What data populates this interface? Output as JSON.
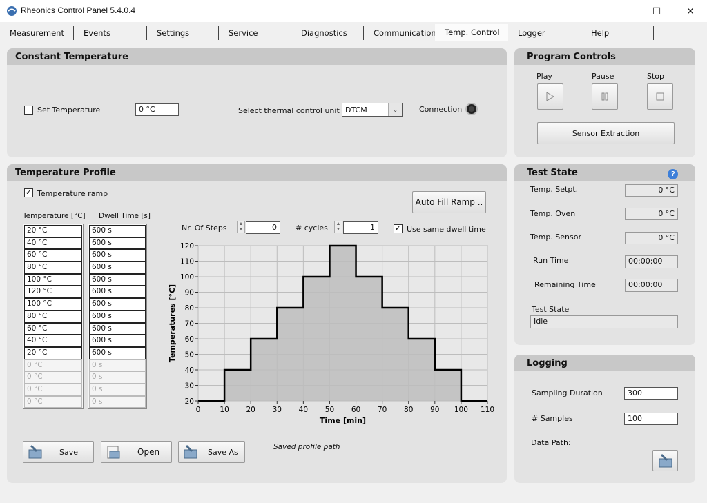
{
  "window": {
    "title": "Rheonics Control Panel 5.4.0.4",
    "min": "—",
    "max": "☐",
    "close": "✕"
  },
  "tabs": [
    {
      "label": "Measurement"
    },
    {
      "label": "Events"
    },
    {
      "label": "Settings"
    },
    {
      "label": "Service"
    },
    {
      "label": "Diagnostics"
    },
    {
      "label": "Communication"
    },
    {
      "label": "Temp. Control"
    },
    {
      "label": "Logger"
    },
    {
      "label": "Help"
    }
  ],
  "constant_temperature": {
    "title": "Constant Temperature",
    "set_temp_label": "Set Temperature",
    "set_temp_checked": false,
    "set_temp_value": "0 °C",
    "select_unit_label": "Select thermal control unit",
    "unit_value": "DTCM",
    "connection_label": "Connection"
  },
  "program_controls": {
    "title": "Program Controls",
    "play_label": "Play",
    "pause_label": "Pause",
    "stop_label": "Stop",
    "sensor_extraction_label": "Sensor Extraction"
  },
  "temperature_profile": {
    "title": "Temperature Profile",
    "ramp_label": "Temperature ramp",
    "ramp_checked": true,
    "auto_fill_label": "Auto Fill Ramp ..",
    "temp_col_header": "Temperature [°C]",
    "dwell_col_header": "Dwell Time [s]",
    "temperatures": [
      "20 °C",
      "40 °C",
      "60 °C",
      "80 °C",
      "100 °C",
      "120 °C",
      "100 °C",
      "80 °C",
      "60 °C",
      "40 °C",
      "20 °C",
      "0 °C",
      "0 °C",
      "0 °C",
      "0 °C"
    ],
    "dwell_times": [
      "600 s",
      "600 s",
      "600 s",
      "600 s",
      "600 s",
      "600 s",
      "600 s",
      "600 s",
      "600 s",
      "600 s",
      "600 s",
      "0 s",
      "0 s",
      "0 s",
      "0 s"
    ],
    "active_rows": 11,
    "steps_label": "Nr. Of Steps",
    "steps_value": "0",
    "cycles_label": "# cycles",
    "cycles_value": "1",
    "same_dwell_label": "Use same dwell time",
    "same_dwell_checked": true,
    "save_label": "Save",
    "open_label": "Open",
    "save_as_label": "Save As",
    "saved_path_label": "Saved profile path"
  },
  "chart_data": {
    "type": "line",
    "title": "",
    "xlabel": "Time [min]",
    "ylabel": "Temperatures [°C]",
    "xlim": [
      0,
      110
    ],
    "ylim": [
      20,
      120
    ],
    "xticks": [
      0,
      10,
      20,
      30,
      40,
      50,
      60,
      70,
      80,
      90,
      100,
      110
    ],
    "yticks": [
      20,
      30,
      40,
      50,
      60,
      70,
      80,
      90,
      100,
      110,
      120
    ],
    "grid": true,
    "series": [
      {
        "x": [
          0,
          10,
          10,
          20,
          20,
          30,
          30,
          40,
          40,
          50,
          50,
          60,
          60,
          70,
          70,
          80,
          80,
          90,
          90,
          100,
          100,
          110
        ],
        "y": [
          20,
          20,
          40,
          40,
          60,
          60,
          80,
          80,
          100,
          100,
          120,
          120,
          100,
          100,
          80,
          80,
          60,
          60,
          40,
          40,
          20,
          20
        ]
      }
    ]
  },
  "test_state": {
    "title": "Test State",
    "help_icon": "?",
    "setpt_label": "Temp. Setpt.",
    "setpt_value": "0 °C",
    "oven_label": "Temp. Oven",
    "oven_value": "0 °C",
    "sensor_label": "Temp. Sensor",
    "sensor_value": "0 °C",
    "run_time_label": "Run Time",
    "run_time_value": "00:00:00",
    "remaining_label": "Remaining Time",
    "remaining_value": "00:00:00",
    "state_label": "Test State",
    "state_value": "Idle"
  },
  "logging": {
    "title": "Logging",
    "sampling_label": "Sampling Duration",
    "sampling_value": "300",
    "samples_label": "# Samples",
    "samples_value": "100",
    "path_label": "Data Path:"
  }
}
